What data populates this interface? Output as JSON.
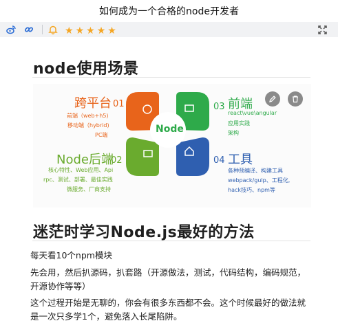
{
  "window": {
    "title": "如何成为一个合格的node开发者"
  },
  "toolbar": {
    "rating_stars": 5
  },
  "sections": [
    {
      "heading": "node使用场景"
    },
    {
      "heading": "迷茫时学习Node.js最好的方法"
    }
  ],
  "diagram": {
    "center_label": "Node",
    "items": [
      {
        "number": "01",
        "title": "跨平台",
        "lines": [
          "前端（web+h5)",
          "移动端（hybrid)",
          "PC端"
        ]
      },
      {
        "number": "02",
        "title": "Node后端",
        "lines": [
          "核心特性、Web应用、Api",
          "rpc、测试、部署、最佳实践",
          "微服务、厂商支持"
        ]
      },
      {
        "number": "03",
        "title": "前端",
        "lines": [
          "react\\vue\\angular",
          "应用实践",
          "架构"
        ]
      },
      {
        "number": "04",
        "title": "工具",
        "lines": [
          "各种预编译、构建工具",
          "webpack/gulp、工程化,",
          "hack技巧、npm等"
        ]
      }
    ],
    "colors": {
      "orange": "#e8641b",
      "green": "#2eaa4a",
      "lightgreen": "#6aab2e",
      "blue": "#2f5fb0"
    }
  },
  "paragraphs": [
    "每天看10个npm模块",
    "先会用，然后扒源码，扒套路（开源做法，测试，代码结构，编码规范，开源协作等等）",
    "这个过程开始是无聊的，你会有很多东西都不会。这个时候最好的做法就是一次只多学1个，避免落入长尾陷阱。"
  ]
}
